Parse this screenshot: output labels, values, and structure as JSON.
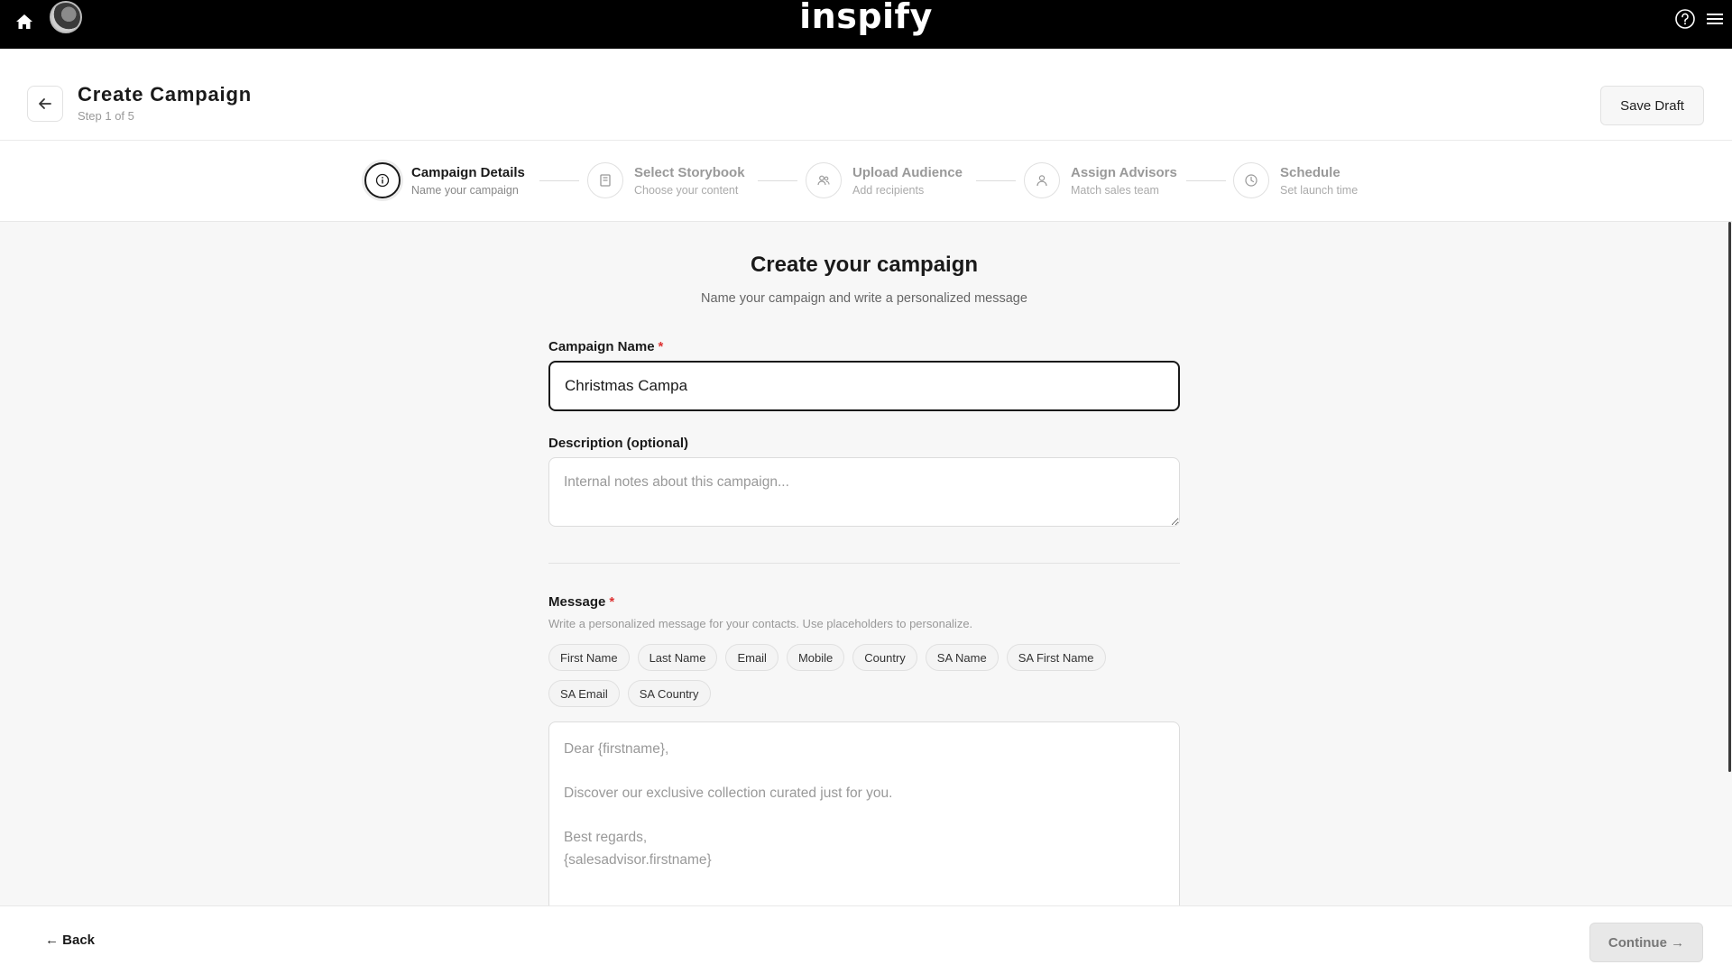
{
  "topbar": {
    "logo": "inspify",
    "icons": {
      "home": "home-icon",
      "help": "help-icon",
      "menu": "menu-icon"
    }
  },
  "header": {
    "title": "Create Campaign",
    "step_count": "Step 1 of 5",
    "save_draft_label": "Save Draft"
  },
  "stepper": {
    "steps": [
      {
        "title": "Campaign Details",
        "subtitle": "Name your campaign",
        "icon": "info-icon",
        "active": true
      },
      {
        "title": "Select Storybook",
        "subtitle": "Choose your content",
        "icon": "book-icon",
        "active": false
      },
      {
        "title": "Upload Audience",
        "subtitle": "Add recipients",
        "icon": "users-icon",
        "active": false
      },
      {
        "title": "Assign Advisors",
        "subtitle": "Match sales team",
        "icon": "user-icon",
        "active": false
      },
      {
        "title": "Schedule",
        "subtitle": "Set launch time",
        "icon": "clock-icon",
        "active": false
      }
    ]
  },
  "form": {
    "title": "Create your campaign",
    "subtitle": "Name your campaign and write a personalized message",
    "campaign_name": {
      "label": "Campaign Name",
      "required_mark": "*",
      "value": "Christmas Campa"
    },
    "description": {
      "label": "Description (optional)",
      "placeholder": "Internal notes about this campaign..."
    },
    "message": {
      "label": "Message",
      "required_mark": "*",
      "help": "Write a personalized message for your contacts. Use placeholders to personalize.",
      "placeholders": [
        "First Name",
        "Last Name",
        "Email",
        "Mobile",
        "Country",
        "SA Name",
        "SA First Name",
        "SA Email",
        "SA Country"
      ],
      "placeholder_text": "Dear {firstname},\n\nDiscover our exclusive collection curated just for you.\n\nBest regards,\n{salesadvisor.firstname}"
    }
  },
  "footer": {
    "back_label": "← Back",
    "continue_label": "Continue →"
  },
  "colors": {
    "primary": "#1a1a1a",
    "topbar": "#000000",
    "required": "#dd3333"
  }
}
